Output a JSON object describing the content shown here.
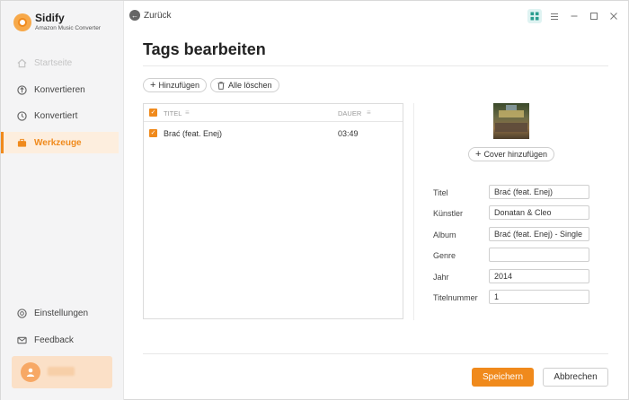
{
  "brand": {
    "name": "Sidify",
    "subtitle": "Amazon Music Converter"
  },
  "sidebar": {
    "items": [
      {
        "label": "Startseite",
        "icon": "home-icon",
        "state": "disabled"
      },
      {
        "label": "Konvertieren",
        "icon": "convert-icon",
        "state": "normal"
      },
      {
        "label": "Konvertiert",
        "icon": "clock-icon",
        "state": "normal"
      },
      {
        "label": "Werkzeuge",
        "icon": "toolbox-icon",
        "state": "active"
      }
    ],
    "bottom": [
      {
        "label": "Einstellungen",
        "icon": "gear-icon"
      },
      {
        "label": "Feedback",
        "icon": "mail-icon"
      }
    ]
  },
  "header": {
    "back_label": "Zurück"
  },
  "page": {
    "title": "Tags bearbeiten"
  },
  "toolbar": {
    "add_label": "Hinzufügen",
    "clear_label": "Alle löschen"
  },
  "table": {
    "columns": [
      "TITEL",
      "DAUER"
    ],
    "rows": [
      {
        "title": "Brać (feat. Enej)",
        "duration": "03:49",
        "checked": true
      }
    ]
  },
  "cover": {
    "add_label": "Cover hinzufügen"
  },
  "form": {
    "title": {
      "label": "Titel",
      "value": "Brać (feat. Enej)"
    },
    "artist": {
      "label": "Künstler",
      "value": "Donatan & Cleo"
    },
    "album": {
      "label": "Album",
      "value": "Brać (feat. Enej) - Single"
    },
    "genre": {
      "label": "Genre",
      "value": ""
    },
    "year": {
      "label": "Jahr",
      "value": "2014"
    },
    "track": {
      "label": "Titelnummer",
      "value": "1"
    }
  },
  "actions": {
    "save_label": "Speichern",
    "cancel_label": "Abbrechen"
  },
  "colors": {
    "accent": "#f08a1c",
    "sidebar_bg": "#f4f4f5",
    "active_bg": "#fdeede"
  }
}
